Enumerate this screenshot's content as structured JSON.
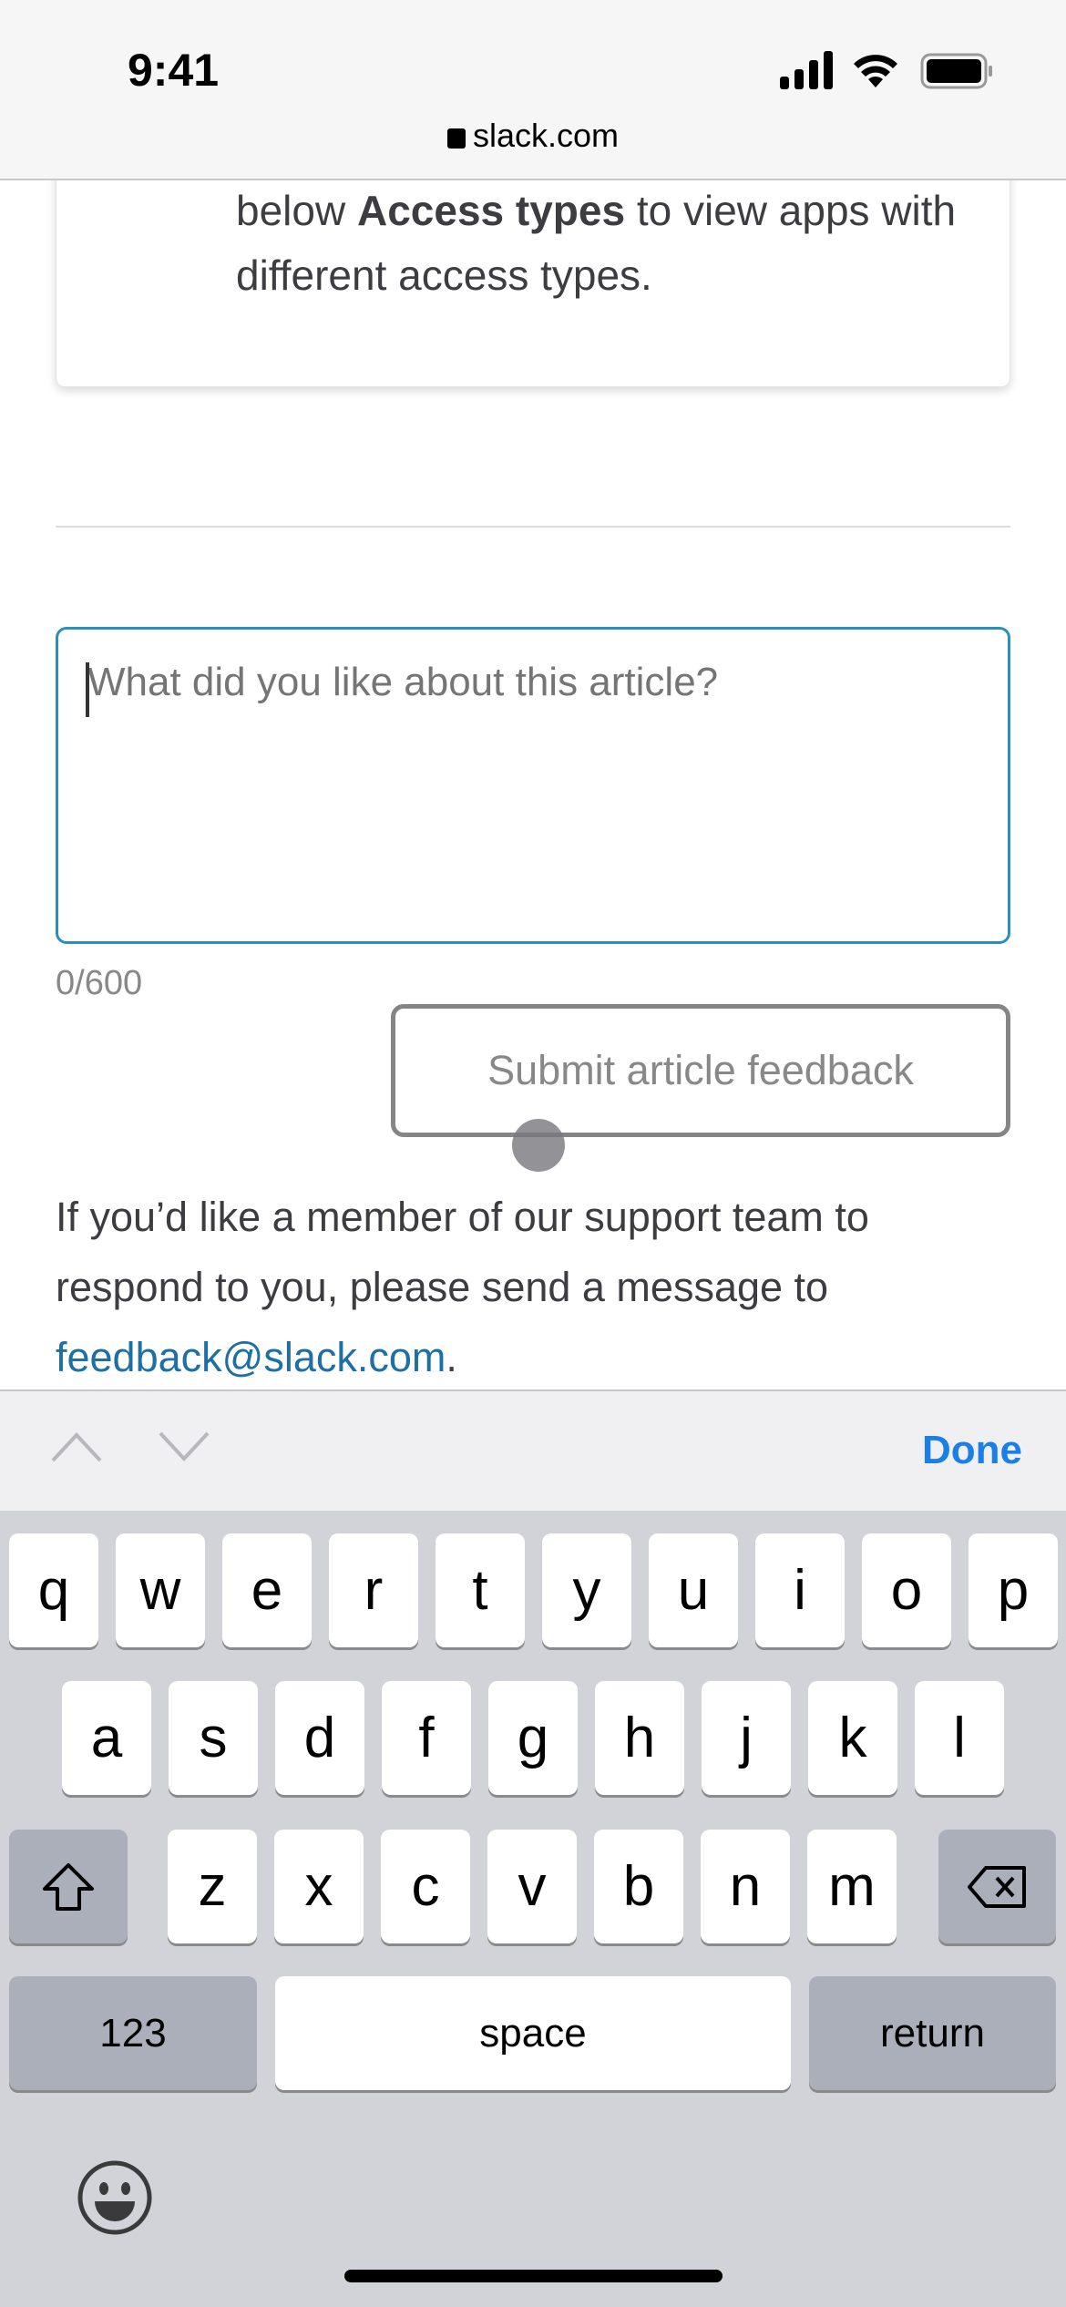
{
  "status_bar": {
    "time": "9:41"
  },
  "browser": {
    "url": "slack.com"
  },
  "card": {
    "text_before": "below ",
    "text_bold": "Access types",
    "text_after": " to view apps with different access types."
  },
  "feedback": {
    "placeholder": "What did you like about this article?",
    "value": "",
    "counter": "0/600",
    "submit_label": "Submit article feedback"
  },
  "support": {
    "text": "If you’d like a member of our support team to respond to you, please send a message to ",
    "email": "feedback@slack.com",
    "end": "."
  },
  "accessory": {
    "done_label": "Done"
  },
  "keyboard": {
    "row1": [
      "q",
      "w",
      "e",
      "r",
      "t",
      "y",
      "u",
      "i",
      "o",
      "p"
    ],
    "row2": [
      "a",
      "s",
      "d",
      "f",
      "g",
      "h",
      "j",
      "k",
      "l"
    ],
    "row3": [
      "z",
      "x",
      "c",
      "v",
      "b",
      "n",
      "m"
    ],
    "numbers_label": "123",
    "space_label": "space",
    "return_label": "return"
  },
  "colors": {
    "accent": "#1a7fe6",
    "link": "#1d6fa5",
    "focus_border": "#2a8fbd"
  }
}
